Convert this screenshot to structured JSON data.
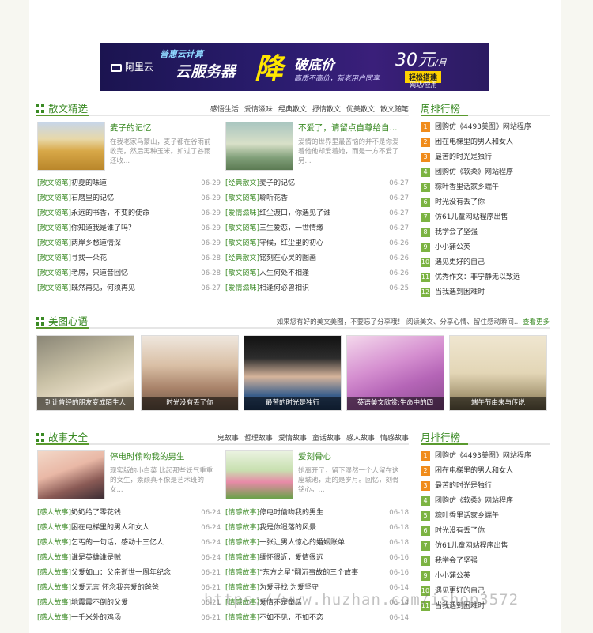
{
  "banner": {
    "logo": "阿里云",
    "line1": "普惠云计算",
    "line2": "云服务器",
    "big": "降",
    "right1": "破底价",
    "right2": "高质不高价，新老用户同享",
    "price": "30元",
    "price_unit": "/月",
    "tag": "轻松搭建",
    "sub": "网站/应用"
  },
  "section1": {
    "title": "散文精选",
    "links": [
      "感悟生活",
      "爱情滋味",
      "经典散文",
      "抒情散文",
      "优美散文",
      "散文随笔"
    ],
    "features": [
      {
        "title": "麦子的记忆",
        "desc": "在我老家乌蒙山，麦子都在谷雨前收完，然后再种玉米。如过了谷雨还收..."
      },
      {
        "title": "不爱了，请留点自尊给自...",
        "desc": "爱情的世界里最苦恼的并不是你爱着他他却爱着她，而是一方不爱了另..."
      }
    ],
    "left_list": [
      {
        "cat": "[散文随笔]",
        "title": "初夏的味道",
        "date": "06-29"
      },
      {
        "cat": "[散文随笔]",
        "title": "石磨里的记忆",
        "date": "06-29"
      },
      {
        "cat": "[散文随笔]",
        "title": "永远的书香，不变的使命",
        "date": "06-29"
      },
      {
        "cat": "[散文随笔]",
        "title": "你知道我是谁了吗？",
        "date": "06-29"
      },
      {
        "cat": "[散文随笔]",
        "title": "两岸乡愁道情深",
        "date": "06-29"
      },
      {
        "cat": "[散文随笔]",
        "title": "寻找一朵花",
        "date": "06-28"
      },
      {
        "cat": "[散文随笔]",
        "title": "老房，只道音回忆",
        "date": "06-28"
      },
      {
        "cat": "[散文随笔]",
        "title": "既然再见，何须再见",
        "date": "06-27"
      }
    ],
    "right_list": [
      {
        "cat": "[经典散文]",
        "title": "麦子的记忆",
        "date": "06-27"
      },
      {
        "cat": "[散文随笔]",
        "title": "聆听花香",
        "date": "06-27"
      },
      {
        "cat": "[爱情滋味]",
        "title": "红尘渡口，你遇见了谁",
        "date": "06-27"
      },
      {
        "cat": "[散文随笔]",
        "title": "三生爱恋，一世情缘",
        "date": "06-27"
      },
      {
        "cat": "[散文随笔]",
        "title": "守候，红尘里的初心",
        "date": "06-26"
      },
      {
        "cat": "[经典散文]",
        "title": "铭刻在心灵的图画",
        "date": "06-26"
      },
      {
        "cat": "[散文随笔]",
        "title": "人生何处不相逢",
        "date": "06-26"
      },
      {
        "cat": "[爱情滋味]",
        "title": "相逢何必曾相识",
        "date": "06-25"
      }
    ]
  },
  "rank1": {
    "title": "周排行榜",
    "items": [
      "团购仿《4493美图》网站程序",
      "困在电梯里的男人和女人",
      "最苦的时光是独行",
      "团购仿《软柔》网站程序",
      "粽叶香里话家乡端午",
      "时光没有丢了你",
      "仿61儿童网站程序出售",
      "我学会了坚强",
      "小小蒲公英",
      "遇见更好的自己",
      "优秀作文：非宁静无以致远",
      "当我遇到困难时"
    ]
  },
  "section2": {
    "title": "美图心语",
    "note": "如果您有好的美文美图，不要忘了分享哦！ 阅读美文、分享心情、留住感动瞬间...",
    "more": "查看更多",
    "items": [
      "别让曾经的朋友变成陌生人",
      "时光没有丢了你",
      "最苦的时光是独行",
      "英语美文欣赏:生命中的四",
      "端午节由来与传说"
    ]
  },
  "section3": {
    "title": "故事大全",
    "links": [
      "鬼故事",
      "哲理故事",
      "爱情故事",
      "童话故事",
      "感人故事",
      "情感故事"
    ],
    "features": [
      {
        "title": "停电时偷吻我的男生",
        "desc": "现实版的小白菜 比起那些妖气重重的女生，素颜真不像是艺术班的女..."
      },
      {
        "title": "爱刻骨心",
        "desc": "她离开了，留下湿然一个人留在这座城池，走的是岁月。回忆，刻骨铭心，..."
      }
    ],
    "left_list": [
      {
        "cat": "[感人故事]",
        "title": "奶奶给了零花钱",
        "date": "06-24"
      },
      {
        "cat": "[感人故事]",
        "title": "困在电梯里的男人和女人",
        "date": "06-24"
      },
      {
        "cat": "[感人故事]",
        "title": "乞丐的一句话，感动十三亿人",
        "date": "06-24"
      },
      {
        "cat": "[感人故事]",
        "title": "谁是英雄谁是贼",
        "date": "06-24"
      },
      {
        "cat": "[感人故事]",
        "title": "父爱如山：父亲逝世一周年纪念",
        "date": "06-21"
      },
      {
        "cat": "[感人故事]",
        "title": "父爱无言 怀念我亲爱的爸爸",
        "date": "06-21"
      },
      {
        "cat": "[感人故事]",
        "title": "地震震不倒的父爱",
        "date": "06-21"
      },
      {
        "cat": "[感人故事]",
        "title": "一千米外的鸡汤",
        "date": "06-21"
      }
    ],
    "right_list": [
      {
        "cat": "[情感故事]",
        "title": "停电时偷吻我的男生",
        "date": "06-18"
      },
      {
        "cat": "[情感故事]",
        "title": "我是你遗落的风景",
        "date": "06-18"
      },
      {
        "cat": "[情感故事]",
        "title": "一张让男人惊心的婚姻账单",
        "date": "06-18"
      },
      {
        "cat": "[情感故事]",
        "title": "缅怀很近，爱情很远",
        "date": "06-16"
      },
      {
        "cat": "[情感故事]",
        "title": "\"东方之星\"翻沉事故的三个故事",
        "date": "06-16"
      },
      {
        "cat": "[情感故事]",
        "title": "为爱寻找 为爱坚守",
        "date": "06-14"
      },
      {
        "cat": "[情感故事]",
        "title": "爱情不是童话",
        "date": "06-14"
      },
      {
        "cat": "[情感故事]",
        "title": "不如不见，不如不恋",
        "date": "06-14"
      }
    ]
  },
  "rank2": {
    "title": "月排行榜",
    "items": [
      "团购仿《4493美图》网站程序",
      "困在电梯里的男人和女人",
      "最苦的时光是独行",
      "团购仿《软柔》网站程序",
      "粽叶香里话家乡端午",
      "时光没有丢了你",
      "仿61儿童网站程序出售",
      "我学会了坚强",
      "小小蒲公英",
      "遇见更好的自己",
      "当我遇到困难时"
    ]
  },
  "watermark": "https://www.huzhan.com/ishop3572"
}
